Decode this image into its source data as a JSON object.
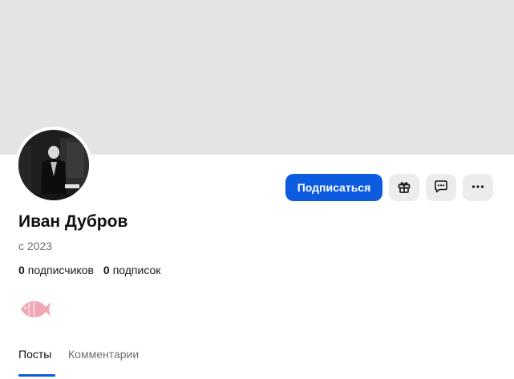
{
  "profile": {
    "name": "Иван Дубров",
    "since": "с 2023",
    "followers_count": "0",
    "followers_label": "подписчиков",
    "following_count": "0",
    "following_label": "подписок",
    "badge_icon": "fish-icon"
  },
  "actions": {
    "subscribe_label": "Подписаться",
    "gift_icon": "gift-icon",
    "message_icon": "message-icon",
    "more_icon": "more-icon"
  },
  "tabs": [
    {
      "label": "Посты",
      "active": true
    },
    {
      "label": "Комментарии",
      "active": false
    }
  ],
  "colors": {
    "accent": "#0d5ce0",
    "cover": "#e4e4e4",
    "icon_button_bg": "#ececec",
    "badge": "#f0a7b5"
  }
}
